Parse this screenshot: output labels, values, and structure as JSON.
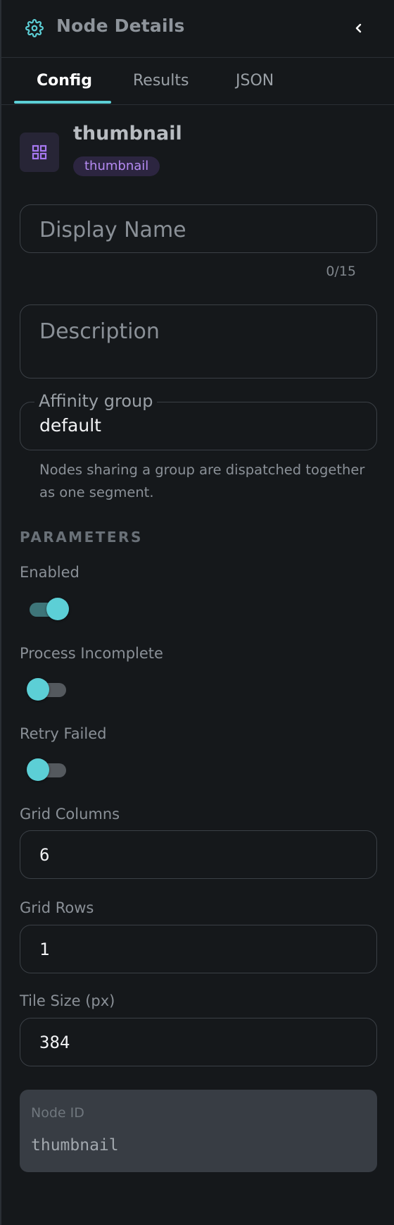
{
  "header": {
    "title": "Node Details",
    "icon": "gear-icon",
    "collapse_icon": "chevron-left-icon"
  },
  "tabs": [
    {
      "label": "Config",
      "active": true
    },
    {
      "label": "Results",
      "active": false
    },
    {
      "label": "JSON",
      "active": false
    }
  ],
  "node": {
    "icon": "grid-icon",
    "name": "thumbnail",
    "type_chip": "thumbnail"
  },
  "display_name": {
    "placeholder": "Display Name",
    "value": "",
    "counter": "0/15"
  },
  "description": {
    "placeholder": "Description",
    "value": ""
  },
  "affinity": {
    "label": "Affinity group",
    "value": "default",
    "helper": "Nodes sharing a group are dispatched together as one segment."
  },
  "parameters": {
    "heading": "PARAMETERS",
    "enabled": {
      "label": "Enabled",
      "on": true
    },
    "process_incomplete": {
      "label": "Process Incomplete",
      "on": false
    },
    "retry_failed": {
      "label": "Retry Failed",
      "on": false
    },
    "grid_columns": {
      "label": "Grid Columns",
      "value": "6"
    },
    "grid_rows": {
      "label": "Grid Rows",
      "value": "1"
    },
    "tile_size": {
      "label": "Tile Size (px)",
      "value": "384"
    }
  },
  "node_id": {
    "label": "Node ID",
    "value": "thumbnail"
  },
  "colors": {
    "accent": "#5ccfd6",
    "chip_text": "#b58bf2",
    "background": "#15181b"
  }
}
